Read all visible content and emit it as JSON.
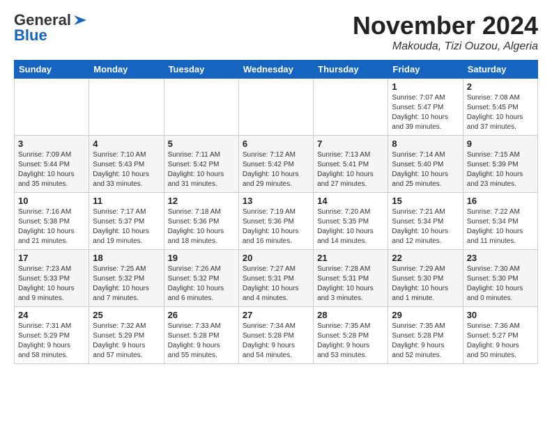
{
  "header": {
    "logo_general": "General",
    "logo_blue": "Blue",
    "month_title": "November 2024",
    "location": "Makouda, Tizi Ouzou, Algeria"
  },
  "weekdays": [
    "Sunday",
    "Monday",
    "Tuesday",
    "Wednesday",
    "Thursday",
    "Friday",
    "Saturday"
  ],
  "weeks": [
    [
      {
        "day": "",
        "info": ""
      },
      {
        "day": "",
        "info": ""
      },
      {
        "day": "",
        "info": ""
      },
      {
        "day": "",
        "info": ""
      },
      {
        "day": "",
        "info": ""
      },
      {
        "day": "1",
        "info": "Sunrise: 7:07 AM\nSunset: 5:47 PM\nDaylight: 10 hours\nand 39 minutes."
      },
      {
        "day": "2",
        "info": "Sunrise: 7:08 AM\nSunset: 5:45 PM\nDaylight: 10 hours\nand 37 minutes."
      }
    ],
    [
      {
        "day": "3",
        "info": "Sunrise: 7:09 AM\nSunset: 5:44 PM\nDaylight: 10 hours\nand 35 minutes."
      },
      {
        "day": "4",
        "info": "Sunrise: 7:10 AM\nSunset: 5:43 PM\nDaylight: 10 hours\nand 33 minutes."
      },
      {
        "day": "5",
        "info": "Sunrise: 7:11 AM\nSunset: 5:42 PM\nDaylight: 10 hours\nand 31 minutes."
      },
      {
        "day": "6",
        "info": "Sunrise: 7:12 AM\nSunset: 5:42 PM\nDaylight: 10 hours\nand 29 minutes."
      },
      {
        "day": "7",
        "info": "Sunrise: 7:13 AM\nSunset: 5:41 PM\nDaylight: 10 hours\nand 27 minutes."
      },
      {
        "day": "8",
        "info": "Sunrise: 7:14 AM\nSunset: 5:40 PM\nDaylight: 10 hours\nand 25 minutes."
      },
      {
        "day": "9",
        "info": "Sunrise: 7:15 AM\nSunset: 5:39 PM\nDaylight: 10 hours\nand 23 minutes."
      }
    ],
    [
      {
        "day": "10",
        "info": "Sunrise: 7:16 AM\nSunset: 5:38 PM\nDaylight: 10 hours\nand 21 minutes."
      },
      {
        "day": "11",
        "info": "Sunrise: 7:17 AM\nSunset: 5:37 PM\nDaylight: 10 hours\nand 19 minutes."
      },
      {
        "day": "12",
        "info": "Sunrise: 7:18 AM\nSunset: 5:36 PM\nDaylight: 10 hours\nand 18 minutes."
      },
      {
        "day": "13",
        "info": "Sunrise: 7:19 AM\nSunset: 5:36 PM\nDaylight: 10 hours\nand 16 minutes."
      },
      {
        "day": "14",
        "info": "Sunrise: 7:20 AM\nSunset: 5:35 PM\nDaylight: 10 hours\nand 14 minutes."
      },
      {
        "day": "15",
        "info": "Sunrise: 7:21 AM\nSunset: 5:34 PM\nDaylight: 10 hours\nand 12 minutes."
      },
      {
        "day": "16",
        "info": "Sunrise: 7:22 AM\nSunset: 5:34 PM\nDaylight: 10 hours\nand 11 minutes."
      }
    ],
    [
      {
        "day": "17",
        "info": "Sunrise: 7:23 AM\nSunset: 5:33 PM\nDaylight: 10 hours\nand 9 minutes."
      },
      {
        "day": "18",
        "info": "Sunrise: 7:25 AM\nSunset: 5:32 PM\nDaylight: 10 hours\nand 7 minutes."
      },
      {
        "day": "19",
        "info": "Sunrise: 7:26 AM\nSunset: 5:32 PM\nDaylight: 10 hours\nand 6 minutes."
      },
      {
        "day": "20",
        "info": "Sunrise: 7:27 AM\nSunset: 5:31 PM\nDaylight: 10 hours\nand 4 minutes."
      },
      {
        "day": "21",
        "info": "Sunrise: 7:28 AM\nSunset: 5:31 PM\nDaylight: 10 hours\nand 3 minutes."
      },
      {
        "day": "22",
        "info": "Sunrise: 7:29 AM\nSunset: 5:30 PM\nDaylight: 10 hours\nand 1 minute."
      },
      {
        "day": "23",
        "info": "Sunrise: 7:30 AM\nSunset: 5:30 PM\nDaylight: 10 hours\nand 0 minutes."
      }
    ],
    [
      {
        "day": "24",
        "info": "Sunrise: 7:31 AM\nSunset: 5:29 PM\nDaylight: 9 hours\nand 58 minutes."
      },
      {
        "day": "25",
        "info": "Sunrise: 7:32 AM\nSunset: 5:29 PM\nDaylight: 9 hours\nand 57 minutes."
      },
      {
        "day": "26",
        "info": "Sunrise: 7:33 AM\nSunset: 5:28 PM\nDaylight: 9 hours\nand 55 minutes."
      },
      {
        "day": "27",
        "info": "Sunrise: 7:34 AM\nSunset: 5:28 PM\nDaylight: 9 hours\nand 54 minutes."
      },
      {
        "day": "28",
        "info": "Sunrise: 7:35 AM\nSunset: 5:28 PM\nDaylight: 9 hours\nand 53 minutes."
      },
      {
        "day": "29",
        "info": "Sunrise: 7:35 AM\nSunset: 5:28 PM\nDaylight: 9 hours\nand 52 minutes."
      },
      {
        "day": "30",
        "info": "Sunrise: 7:36 AM\nSunset: 5:27 PM\nDaylight: 9 hours\nand 50 minutes."
      }
    ]
  ]
}
